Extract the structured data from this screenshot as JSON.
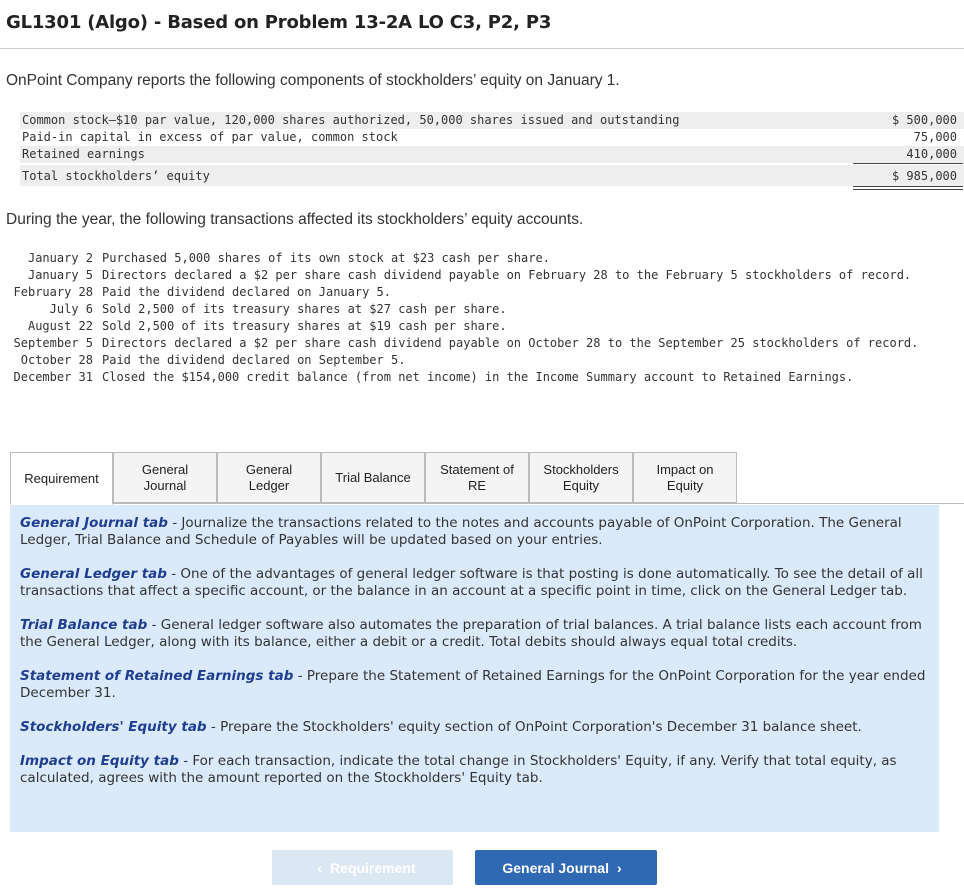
{
  "title": "GL1301 (Algo) - Based on Problem 13-2A LO C3, P2, P3",
  "intro": "OnPoint Company reports the following components of stockholders’ equity on January 1.",
  "equity": {
    "rows": [
      {
        "label": "Common stock—$10 par value, 120,000 shares authorized, 50,000 shares issued and outstanding",
        "amount": "$ 500,000"
      },
      {
        "label": "Paid-in capital in excess of par value, common stock",
        "amount": "75,000"
      },
      {
        "label": "Retained earnings",
        "amount": "410,000"
      }
    ],
    "total": {
      "label": "Total stockholders’ equity",
      "amount": "$ 985,000"
    }
  },
  "during": "During the year, the following transactions affected its stockholders’ equity accounts.",
  "transactions": [
    {
      "date": "January 2",
      "desc": "Purchased 5,000 shares of its own stock at $23 cash per share."
    },
    {
      "date": "January 5",
      "desc": "Directors declared a $2 per share cash dividend payable on February 28 to the February 5 stockholders of record."
    },
    {
      "date": "February 28",
      "desc": "Paid the dividend declared on January 5."
    },
    {
      "date": "July 6",
      "desc": "Sold 2,500 of its treasury shares at $27 cash per share."
    },
    {
      "date": "August 22",
      "desc": "Sold 2,500 of its treasury shares at $19 cash per share."
    },
    {
      "date": "September 5",
      "desc": "Directors declared a $2 per share cash dividend payable on October 28 to the September 25 stockholders of record."
    },
    {
      "date": "October 28",
      "desc": "Paid the dividend declared on September 5."
    },
    {
      "date": "December 31",
      "desc": "Closed the $154,000 credit balance (from net income) in the Income Summary account to Retained Earnings."
    }
  ],
  "tabs": [
    {
      "line1": "Requirement",
      "line2": ""
    },
    {
      "line1": "General",
      "line2": "Journal"
    },
    {
      "line1": "General",
      "line2": "Ledger"
    },
    {
      "line1": "Trial Balance",
      "line2": ""
    },
    {
      "line1": "Statement of",
      "line2": "RE"
    },
    {
      "line1": "Stockholders",
      "line2": "Equity"
    },
    {
      "line1": "Impact on",
      "line2": "Equity"
    }
  ],
  "panel": [
    {
      "name": "General Journal tab",
      "text": " - Journalize the transactions related to the notes and accounts payable of OnPoint Corporation. The General Ledger, Trial Balance and Schedule of Payables will be updated based on your entries."
    },
    {
      "name": "General Ledger tab",
      "text": " - One of the advantages of general ledger software is that posting is done automatically. To see the detail of all transactions that affect a specific account, or the balance in an account at a specific point in time, click on the General Ledger tab."
    },
    {
      "name": "Trial Balance tab",
      "text": " - General ledger software also automates the preparation of trial balances. A trial balance lists each account from the General Ledger, along with its balance, either a debit or a credit. Total debits should always equal total credits."
    },
    {
      "name": "Statement of Retained Earnings tab",
      "text": " - Prepare the Statement of Retained Earnings for the OnPoint Corporation for the year ended December 31."
    },
    {
      "name": "Stockholders' Equity tab",
      "text": " - Prepare the Stockholders' equity section of OnPoint Corporation's December 31 balance sheet."
    },
    {
      "name": "Impact on Equity tab",
      "text": " - For each transaction, indicate the total change in Stockholders' Equity, if any. Verify that total equity, as calculated, agrees with the amount reported on the Stockholders' Equity tab."
    }
  ],
  "nav": {
    "prev": "Requirement",
    "next": "General Journal"
  },
  "colors": {
    "accent": "#2f69b3",
    "panel_bg": "#dbeafa",
    "tab_name": "#1f3e8f"
  }
}
